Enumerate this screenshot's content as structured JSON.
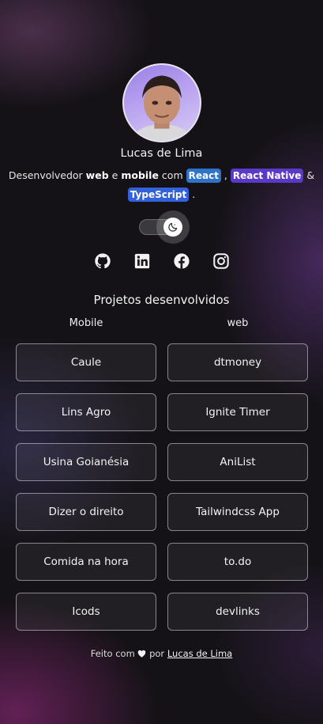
{
  "profile": {
    "name": "Lucas de Lima",
    "bio_prefix": "Desenvolvedor",
    "bio_web": "web",
    "bio_e": "e",
    "bio_mobile": "mobile",
    "bio_com": "com",
    "tag_react": "React",
    "comma": ",",
    "tag_react_native": "React Native",
    "amp": "&",
    "tag_typescript": "TypeScript",
    "period": "."
  },
  "theme_toggle": {
    "icon": "moon-icon",
    "state": "dark"
  },
  "socials": [
    {
      "icon": "github-icon"
    },
    {
      "icon": "linkedin-icon"
    },
    {
      "icon": "facebook-icon"
    },
    {
      "icon": "instagram-icon"
    }
  ],
  "projects": {
    "title": "Projetos desenvolvidos",
    "mobile_heading": "Mobile",
    "web_heading": "web",
    "mobile": [
      "Caule",
      "Lins Agro",
      "Usina Goianésia",
      "Dizer o direito",
      "Comida na hora",
      "Icods"
    ],
    "web": [
      "dtmoney",
      "Ignite Timer",
      "AniList",
      "Tailwindcss App",
      "to.do",
      "devlinks"
    ]
  },
  "footer": {
    "text_before": "Feito com",
    "text_by": "por",
    "author_link": "Lucas de Lima"
  },
  "colors": {
    "react_tag": "#2f73c9",
    "react_native_tag": "#5b39c8",
    "typescript_tag": "#3361d8"
  }
}
